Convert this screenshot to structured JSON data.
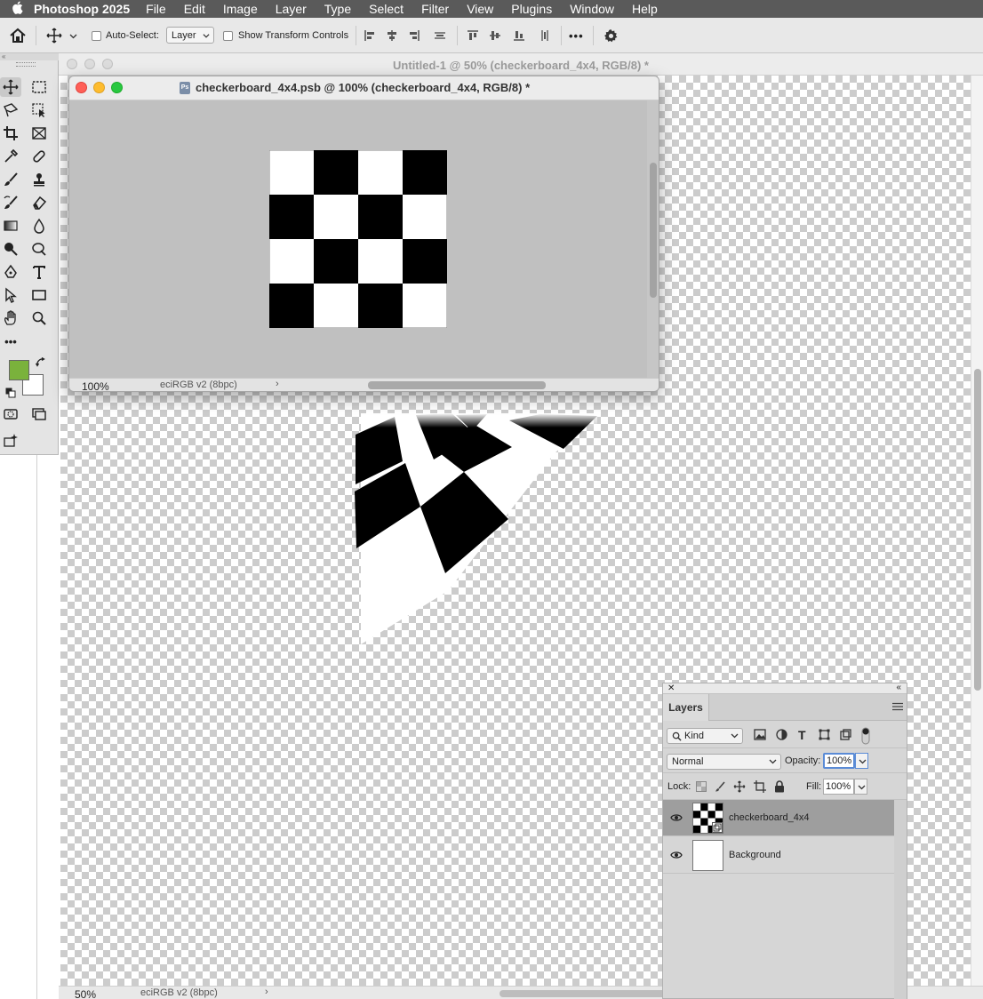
{
  "menubar": {
    "app_name": "Photoshop 2025",
    "menus": [
      "File",
      "Edit",
      "Image",
      "Layer",
      "Type",
      "Select",
      "Filter",
      "View",
      "Plugins",
      "Window",
      "Help"
    ]
  },
  "options_bar": {
    "auto_select_label": "Auto-Select:",
    "auto_select_target": "Layer",
    "show_transform_label": "Show Transform Controls",
    "more_label": "•••"
  },
  "tools_panel": {
    "more_label": "•••",
    "foreground_color": "#7ab23c",
    "background_color": "#ffffff"
  },
  "main_document": {
    "title": "Untitled-1 @ 50% (checkerboard_4x4, RGB/8) *",
    "zoom": "50%",
    "color_profile": "eciRGB v2 (8bpc)",
    "arrow": "›"
  },
  "psb_window": {
    "title": "checkerboard_4x4.psb @ 100% (checkerboard_4x4, RGB/8) *",
    "icon_label": "Ps",
    "zoom": "100%",
    "color_profile": "eciRGB v2 (8bpc)",
    "arrow": "›"
  },
  "layers_panel": {
    "tab": "Layers",
    "filter_kind": "Kind",
    "blend_mode": "Normal",
    "opacity_label": "Opacity:",
    "opacity_value": "100%",
    "lock_label": "Lock:",
    "fill_label": "Fill:",
    "fill_value": "100%",
    "layers": [
      {
        "name": "checkerboard_4x4",
        "selected": true
      },
      {
        "name": "Background",
        "selected": false
      }
    ]
  },
  "colors": {
    "accent_green": "#7ab23c",
    "selected_layer": "#9e9e9e"
  }
}
